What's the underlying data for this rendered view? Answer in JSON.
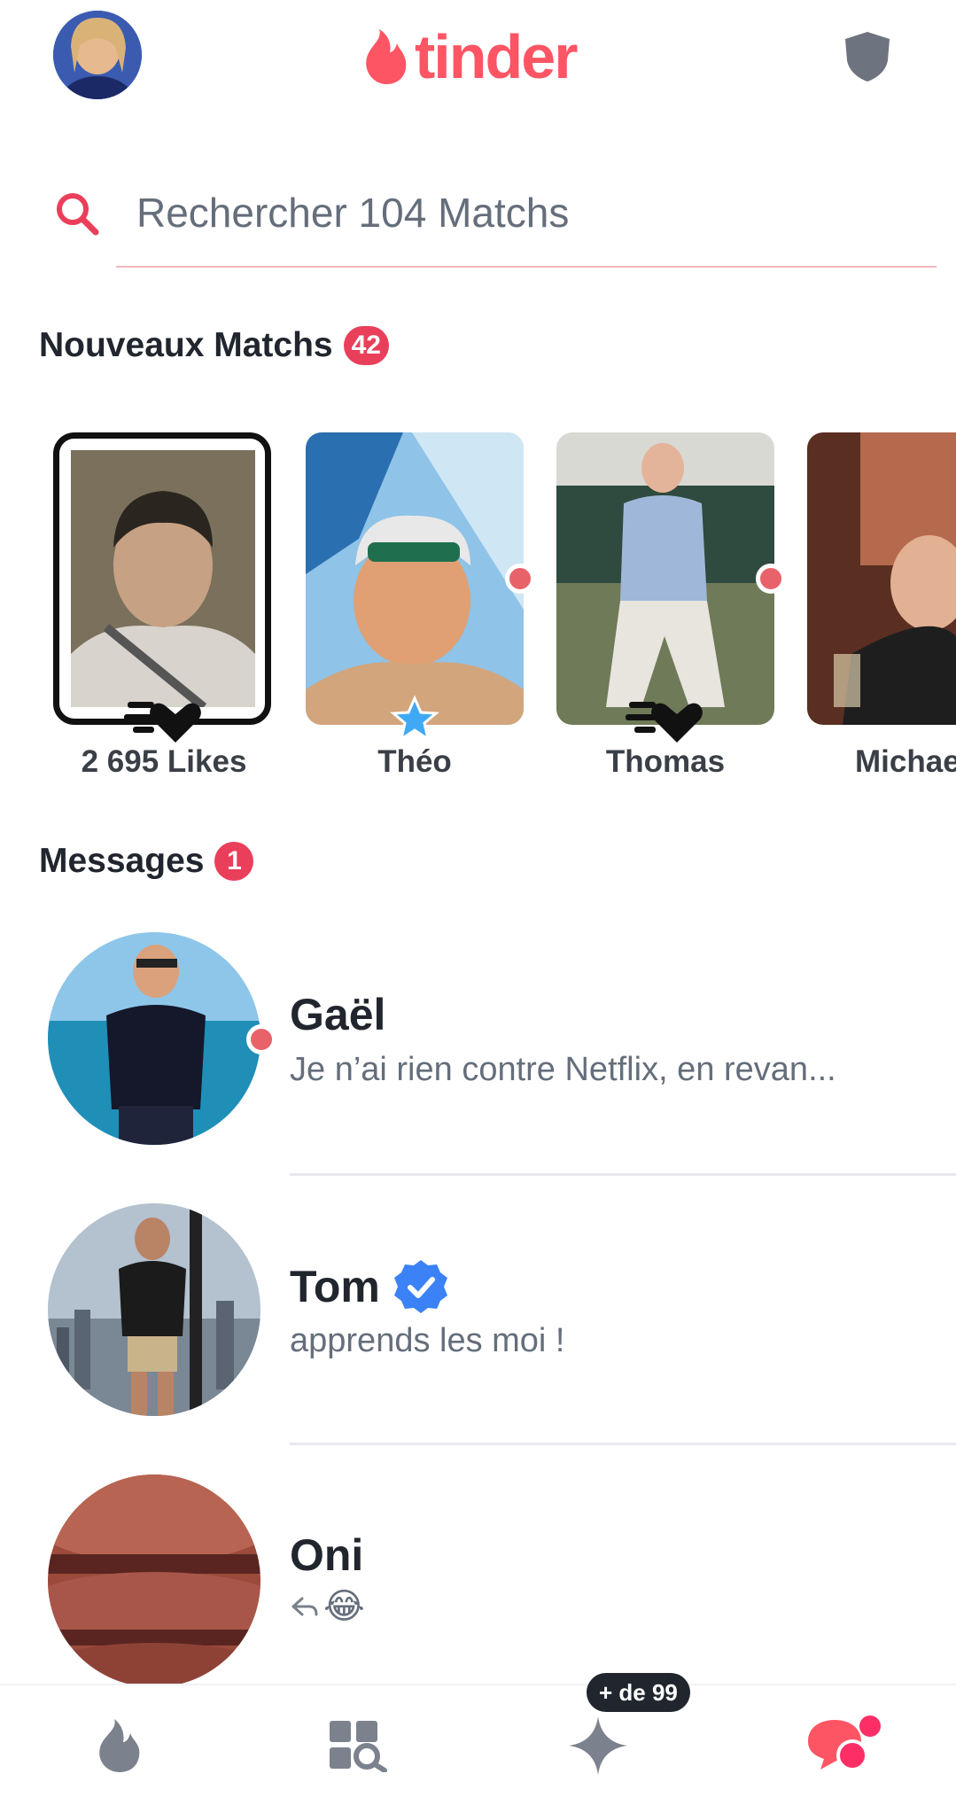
{
  "header": {
    "brand": "tinder",
    "profile_avatar": "profile-avatar",
    "shield_icon": "shield-icon"
  },
  "search": {
    "placeholder": "Rechercher 104 Matchs"
  },
  "new_matches": {
    "title": "Nouveaux Matchs",
    "count": "42",
    "items": [
      {
        "label": "2 695 Likes"
      },
      {
        "label": "Théo"
      },
      {
        "label": "Thomas"
      },
      {
        "label": "Michael"
      }
    ]
  },
  "messages": {
    "title": "Messages",
    "count": "1",
    "items": [
      {
        "name": "Gaël",
        "preview": "Je n’ai rien contre Netflix, en revan..."
      },
      {
        "name": "Tom",
        "preview": "apprends les moi !"
      },
      {
        "name": "Oni",
        "preview": "😂"
      }
    ]
  },
  "bottom_nav": {
    "badge": "+ de 99",
    "items": [
      "flame-icon",
      "explore-icon",
      "spark-icon",
      "chat-icon"
    ]
  },
  "colors": {
    "brand": "#fd5564",
    "badge": "#ea3f5a",
    "verified": "#3b82f6",
    "online_dot": "#e8626a"
  }
}
